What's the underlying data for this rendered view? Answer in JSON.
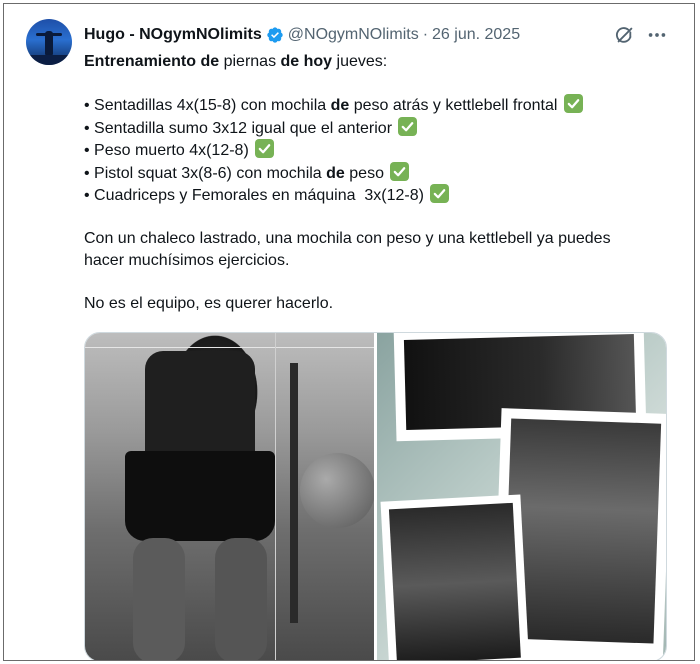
{
  "author": {
    "display_name": "Hugo - NOgymNOlimits",
    "handle": "@NOgymNOlimits",
    "separator": "·",
    "date": "26 jun. 2025",
    "verified_color": "#1d9bf0"
  },
  "icons": {
    "verified": "verified-badge-icon",
    "grok": "grok-icon",
    "more": "more-options-icon",
    "check": "check-mark-button-icon"
  },
  "tweet": {
    "intro_bold_1": "Entrenamiento de",
    "intro_normal_1": " piernas ",
    "intro_bold_2": "de hoy",
    "intro_normal_2": " jueves:",
    "items": [
      {
        "bullet": "• ",
        "before": "Sentadillas 4x(15-8) con mochila ",
        "bold": "de",
        "after": " peso atrás y kettlebell frontal"
      },
      {
        "bullet": "• ",
        "before": "Sentadilla sumo 3x12 igual que el anterior",
        "bold": "",
        "after": ""
      },
      {
        "bullet": "• ",
        "before": "Peso muerto 4x(12-8)",
        "bold": "",
        "after": ""
      },
      {
        "bullet": "• ",
        "before": "Pistol squat 3x(8-6) con mochila ",
        "bold": "de",
        "after": " peso"
      },
      {
        "bullet": "• ",
        "before": "Cuadriceps y Femorales en máquina  3x(12-8)",
        "bold": "",
        "after": ""
      }
    ],
    "paragraph_1_line_1": "Con un chaleco lastrado, una mochila con peso y una kettlebell ya puedes",
    "paragraph_1_line_2": "hacer muchísimos ejercicios.",
    "paragraph_2": "No es el equipo, es querer hacerlo."
  },
  "colors": {
    "text": "#0f1419",
    "secondary": "#536471",
    "check_green": "#77b255"
  }
}
